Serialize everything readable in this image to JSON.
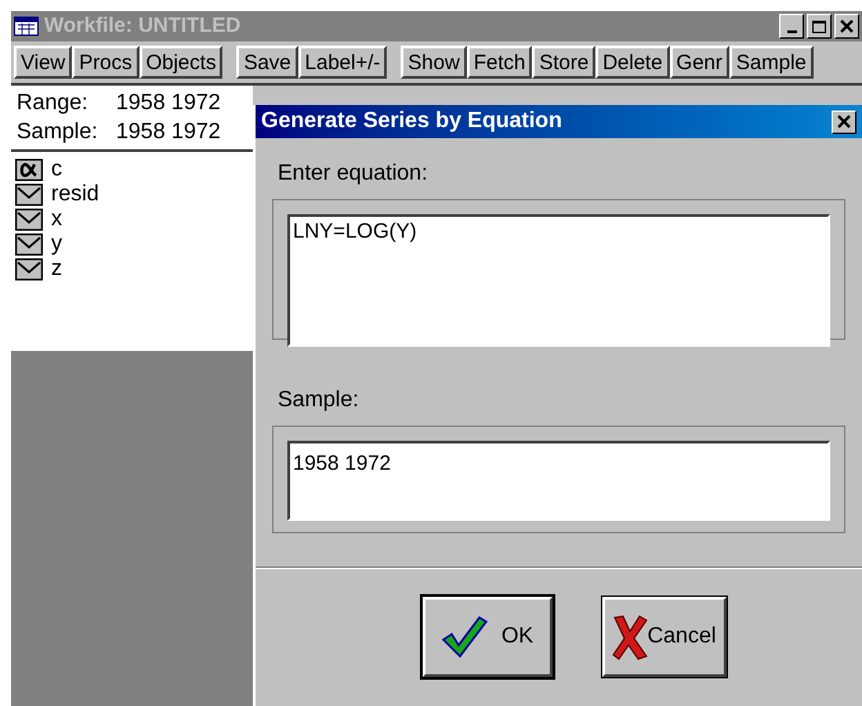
{
  "workfile": {
    "title": "Workfile: UNTITLED",
    "active": false,
    "toolbar_groups": [
      [
        "View",
        "Procs",
        "Objects"
      ],
      [
        "Save",
        "Label+/-"
      ],
      [
        "Show",
        "Fetch",
        "Store",
        "Delete",
        "Genr",
        "Sample"
      ]
    ],
    "range": {
      "label": "Range:",
      "value": "1958 1972"
    },
    "sample": {
      "label": "Sample:",
      "value": "1958 1972"
    },
    "objects": [
      {
        "kind": "coefficient",
        "name": "c"
      },
      {
        "kind": "series",
        "name": "resid"
      },
      {
        "kind": "series",
        "name": "x"
      },
      {
        "kind": "series",
        "name": "y"
      },
      {
        "kind": "series",
        "name": "z"
      }
    ]
  },
  "dialog": {
    "title": "Generate Series by Equation",
    "equation_label": "Enter equation:",
    "equation_value": "LNY=LOG(Y)",
    "sample_label": "Sample:",
    "sample_value": "1958 1972",
    "buttons": [
      {
        "kind": "ok",
        "label": "OK"
      },
      {
        "kind": "cancel",
        "label": "Cancel"
      }
    ]
  }
}
